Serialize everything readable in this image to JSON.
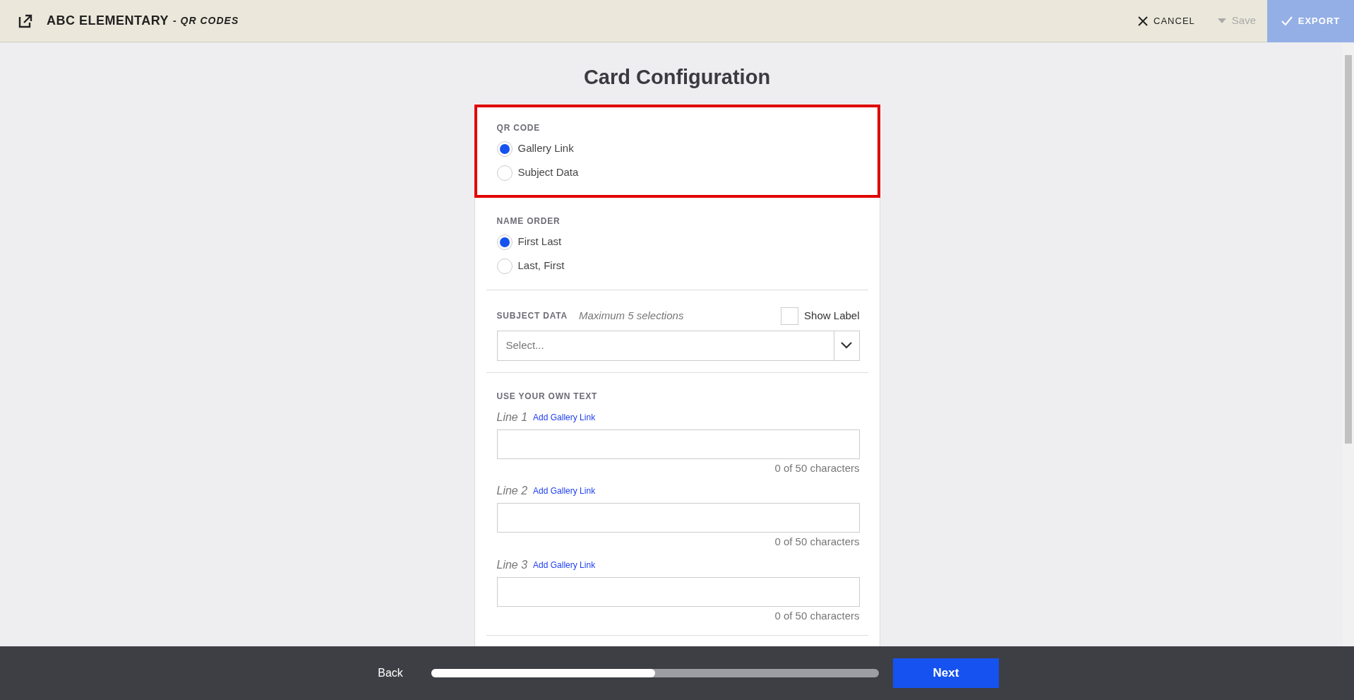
{
  "header": {
    "title": "ABC ELEMENTARY",
    "subtitle": "- QR CODES",
    "cancel": "CANCEL",
    "save": {
      "label": "Save",
      "disabled": true
    },
    "export": {
      "label": "EXPORT",
      "disabled": true
    }
  },
  "page_title": "Card Configuration",
  "sections": [
    {
      "kind": "radio",
      "heading": "QR CODE",
      "highlighted": true,
      "options": [
        {
          "label": "Gallery Link",
          "selected": true
        },
        {
          "label": "Subject Data",
          "selected": false
        }
      ]
    },
    {
      "kind": "radio",
      "heading": "NAME ORDER",
      "highlighted": false,
      "options": [
        {
          "label": "First Last",
          "selected": true
        },
        {
          "label": "Last, First",
          "selected": false
        }
      ]
    },
    {
      "kind": "select",
      "heading": "SUBJECT DATA",
      "hint": "Maximum 5 selections",
      "checkbox": {
        "label": "Show Label",
        "checked": false
      },
      "placeholder": "Select..."
    },
    {
      "kind": "lines",
      "heading": "USE YOUR OWN TEXT",
      "lines": [
        {
          "label": "Line 1",
          "link": "Add Gallery Link",
          "counter": "0 of 50 characters"
        },
        {
          "label": "Line 2",
          "link": "Add Gallery Link",
          "counter": "0 of 50 characters"
        },
        {
          "label": "Line 3",
          "link": "Add Gallery Link",
          "counter": "0 of 50 characters"
        }
      ]
    }
  ],
  "footer": {
    "back": "Back",
    "progress": {
      "level": 0.5
    },
    "next": "Next"
  }
}
